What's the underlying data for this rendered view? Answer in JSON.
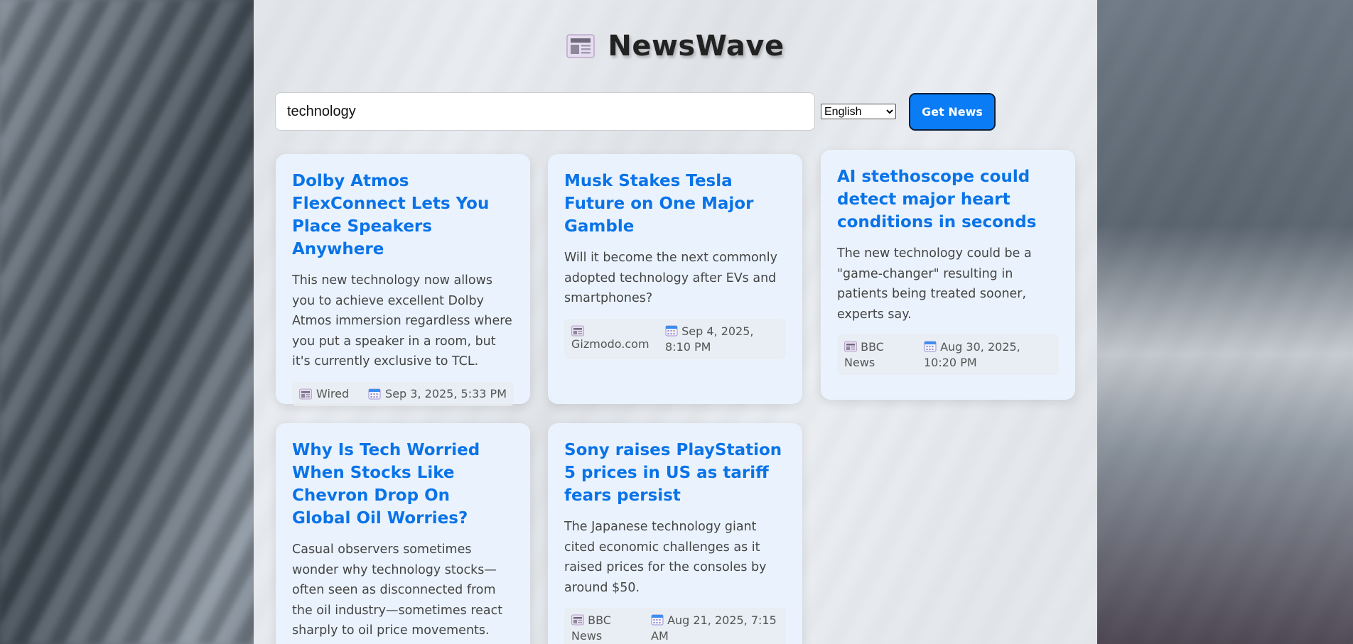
{
  "header": {
    "title": "NewsWave",
    "logo_icon": "newspaper-icon"
  },
  "search": {
    "value": "technology",
    "placeholder": ""
  },
  "language": {
    "selected": "English",
    "options": [
      "English"
    ]
  },
  "button": {
    "get_news_label": "Get News"
  },
  "colors": {
    "accent": "#0a7cf5",
    "title_link": "#0a73e8",
    "card_bg": "#eaf3fd"
  },
  "articles": [
    {
      "title": "Dolby Atmos FlexConnect Lets You Place Speakers Anywhere",
      "description": "This new technology now allows you to achieve excellent Dolby Atmos immersion regardless where you put a speaker in a room, but it's currently exclusive to TCL.",
      "source": "Wired",
      "date": "Sep 3, 2025, 5:33 PM"
    },
    {
      "title": "Musk Stakes Tesla Future on One Major Gamble",
      "description": "Will it become the next commonly adopted technology after EVs and smartphones?",
      "source": "Gizmodo.com",
      "date": "Sep 4, 2025, 8:10 PM"
    },
    {
      "title": "AI stethoscope could detect major heart conditions in seconds",
      "description": "The new technology could be a \"game-changer\" resulting in patients being treated sooner, experts say.",
      "source": "BBC News",
      "date": "Aug 30, 2025, 10:20 PM"
    },
    {
      "title": "Why Is Tech Worried When Stocks Like Chevron Drop On Global Oil Worries?",
      "description": "Casual observers sometimes wonder why technology stocks—often seen as disconnected from the oil industry—sometimes react sharply to oil price movements.",
      "source": "",
      "date": ""
    },
    {
      "title": "Sony raises PlayStation 5 prices in US as tariff fears persist",
      "description": "The Japanese technology giant cited economic challenges as it raised prices for the consoles by around $50.",
      "source": "BBC News",
      "date": "Aug 21, 2025, 7:15 AM"
    }
  ]
}
